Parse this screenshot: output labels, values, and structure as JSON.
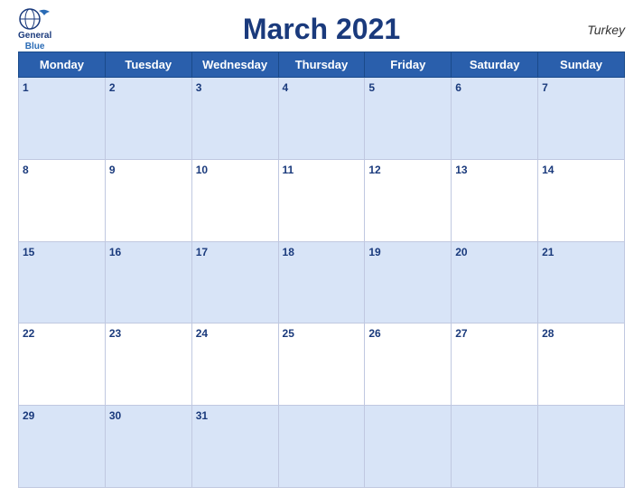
{
  "header": {
    "logo_general": "General",
    "logo_blue": "Blue",
    "title": "March 2021",
    "country": "Turkey"
  },
  "days_of_week": [
    "Monday",
    "Tuesday",
    "Wednesday",
    "Thursday",
    "Friday",
    "Saturday",
    "Sunday"
  ],
  "weeks": [
    [
      1,
      2,
      3,
      4,
      5,
      6,
      7
    ],
    [
      8,
      9,
      10,
      11,
      12,
      13,
      14
    ],
    [
      15,
      16,
      17,
      18,
      19,
      20,
      21
    ],
    [
      22,
      23,
      24,
      25,
      26,
      27,
      28
    ],
    [
      29,
      30,
      31,
      null,
      null,
      null,
      null
    ]
  ],
  "colors": {
    "header_bg": "#2a5fac",
    "row_odd_bg": "#d8e4f7",
    "row_even_bg": "#ffffff",
    "title_color": "#1a3a7c",
    "text_white": "#ffffff"
  }
}
